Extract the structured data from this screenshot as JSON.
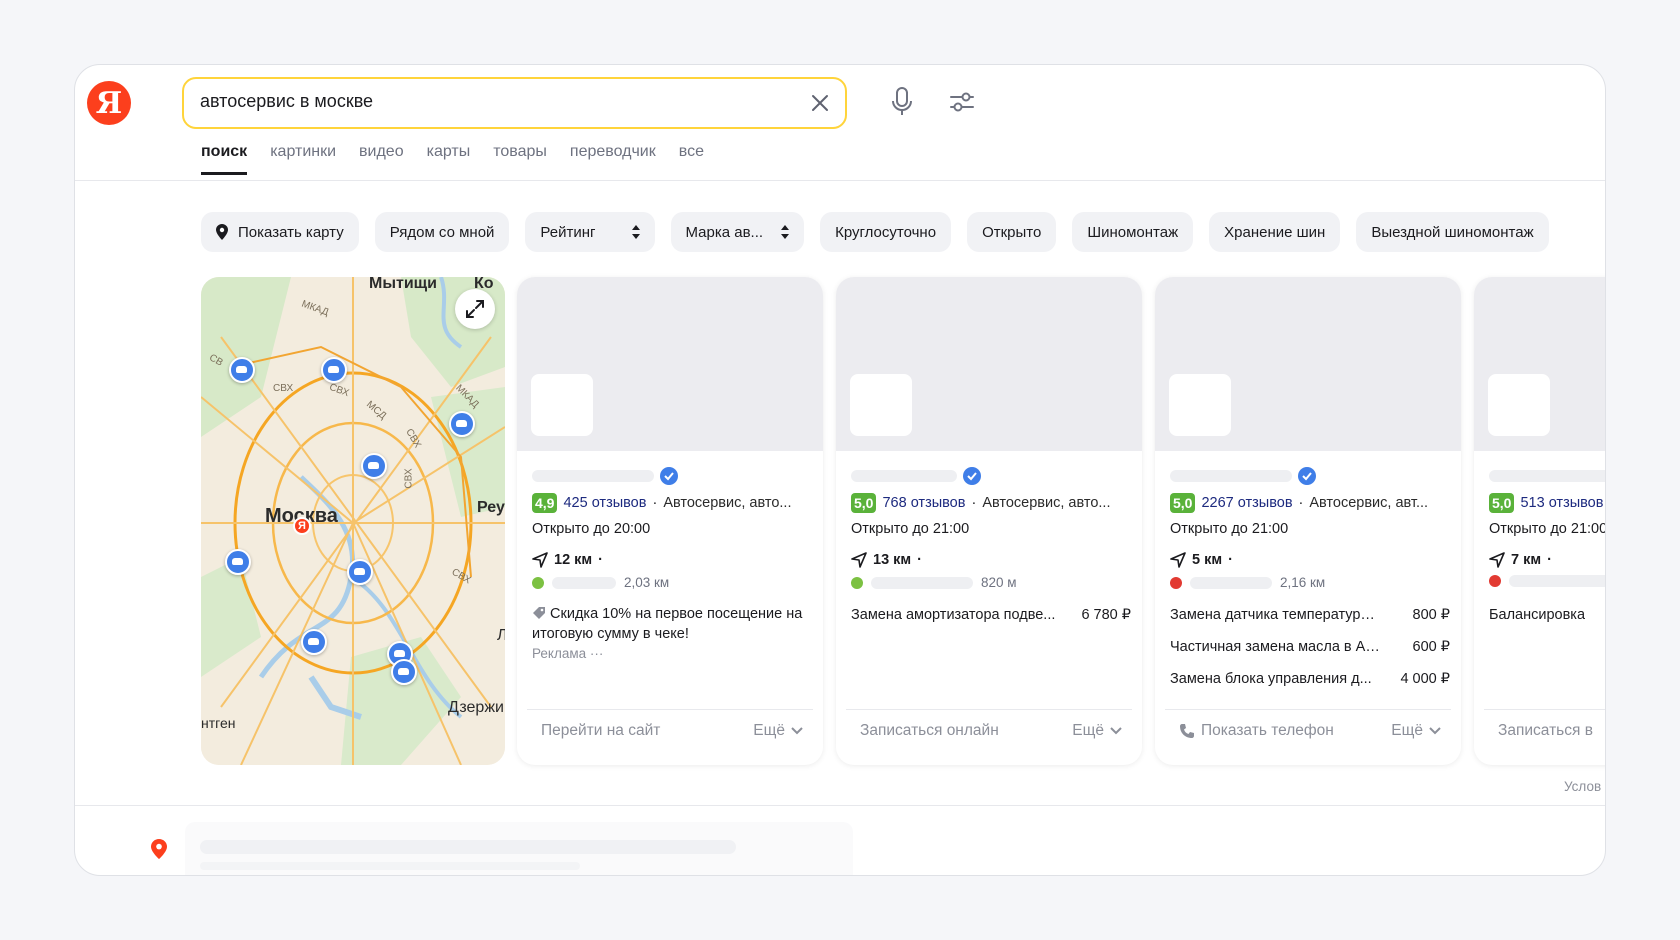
{
  "search": {
    "query": "автосервис в москве",
    "logo_letter": "Я"
  },
  "tabs": [
    {
      "label": "поиск",
      "active": true
    },
    {
      "label": "картинки"
    },
    {
      "label": "видео"
    },
    {
      "label": "карты"
    },
    {
      "label": "товары"
    },
    {
      "label": "переводчик"
    },
    {
      "label": "все"
    }
  ],
  "chips": [
    {
      "label": "Показать карту"
    },
    {
      "label": "Рядом со мной"
    },
    {
      "label": "Рейтинг"
    },
    {
      "label": "Марка ав..."
    },
    {
      "label": "Круглосуточно"
    },
    {
      "label": "Открыто"
    },
    {
      "label": "Шиномонтаж"
    },
    {
      "label": "Хранение шин"
    },
    {
      "label": "Выездной шиномонтаж"
    }
  ],
  "map": {
    "labels": [
      "Мытищи",
      "Ко",
      "Москва",
      "Реу",
      "Дзержи",
      "нтген",
      "Л"
    ],
    "roads": [
      "МКАД",
      "СВХ",
      "СВХ",
      "МСД",
      "СВХ",
      "МКАД",
      "СВХ",
      "СВХ",
      "СВ"
    ],
    "pin_letter": "Я"
  },
  "cards": [
    {
      "rating": "4,9",
      "reviews": "425 отзывов",
      "category": "Автосервис, авто...",
      "hours": "Открыто до 20:00",
      "distance": "12 км",
      "metro_dist": "2,03 км",
      "metro_color": "#7cc142",
      "promo": "Скидка 10% на первое посещение на итоговую сумму в чеке!",
      "ad_label": "Реклама ···",
      "action": "Перейти на сайт",
      "more": "Ещё"
    },
    {
      "rating": "5,0",
      "reviews": "768 отзывов",
      "category": "Автосервис, авто...",
      "hours": "Открыто до 21:00",
      "distance": "13 км",
      "metro_dist": "820 м",
      "metro_color": "#7cc142",
      "services": [
        {
          "name": "Замена амортизатора подве...",
          "price": "6 780 ₽"
        }
      ],
      "action": "Записаться онлайн",
      "more": "Ещё"
    },
    {
      "rating": "5,0",
      "reviews": "2267 отзывов",
      "category": "Автосервис, авт...",
      "hours": "Открыто до 21:00",
      "distance": "5 км",
      "metro_dist": "2,16 км",
      "metro_color": "#e23a32",
      "services": [
        {
          "name": "Замена датчика температуры ...",
          "price": "800 ₽"
        },
        {
          "name": "Частичная замена масла в АК...",
          "price": "600 ₽"
        },
        {
          "name": "Замена блока управления д...",
          "price": "4 000 ₽"
        }
      ],
      "action": "Показать телефон",
      "more": "Ещё"
    },
    {
      "rating": "5,0",
      "reviews": "513 отзывов",
      "category": "",
      "hours": "Открыто до 21:00",
      "distance": "7 км",
      "metro_dist": "",
      "metro_color": "#e23a32",
      "services": [
        {
          "name": "Балансировка",
          "price": ""
        }
      ],
      "action": "Записаться в",
      "more": ""
    }
  ],
  "terms": "Услов",
  "colors": {
    "accent": "#ffd43b",
    "brand": "#fc3f1d",
    "rating": "#5ab23a",
    "link": "#1d2a7f",
    "pin": "#3f7ee8"
  }
}
